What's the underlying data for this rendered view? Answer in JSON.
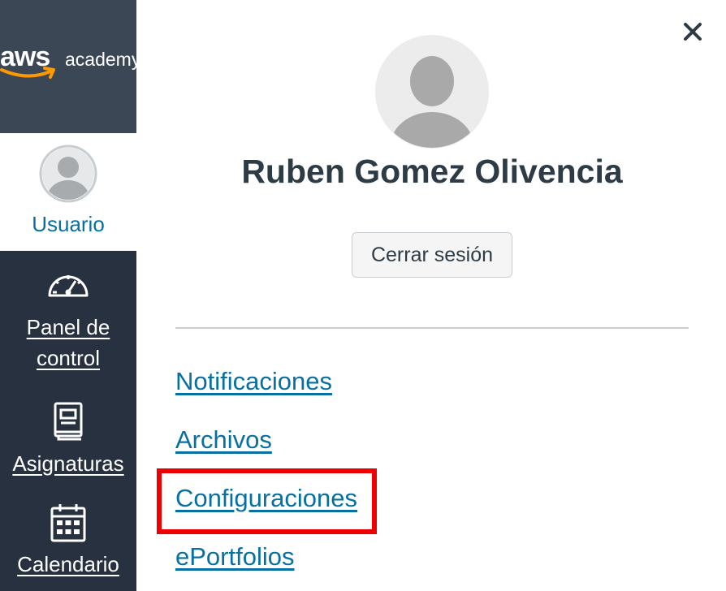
{
  "brand": {
    "logo_main": "aws",
    "logo_sub": "academy",
    "logo_smile_color": "#ff9900"
  },
  "sidebar": {
    "user_label": "Usuario",
    "items": [
      {
        "label_line1": "Panel de",
        "label_line2": "control",
        "icon": "dashboard-icon"
      },
      {
        "label": "Asignaturas",
        "icon": "courses-icon"
      },
      {
        "label": "Calendario",
        "icon": "calendar-icon"
      }
    ]
  },
  "tray": {
    "close_icon": "close-icon",
    "user_name": "Ruben Gomez Olivencia",
    "logout_label": "Cerrar sesión",
    "links": [
      {
        "label": "Notificaciones"
      },
      {
        "label": "Archivos"
      },
      {
        "label": "Configuraciones",
        "highlighted": true
      },
      {
        "label": "ePortfolios"
      }
    ]
  },
  "colors": {
    "sidebar_bg": "#27313f",
    "logo_bg": "#3c4756",
    "link": "#0770a3",
    "highlight": "#ee0000",
    "heading": "#2d3b45"
  }
}
